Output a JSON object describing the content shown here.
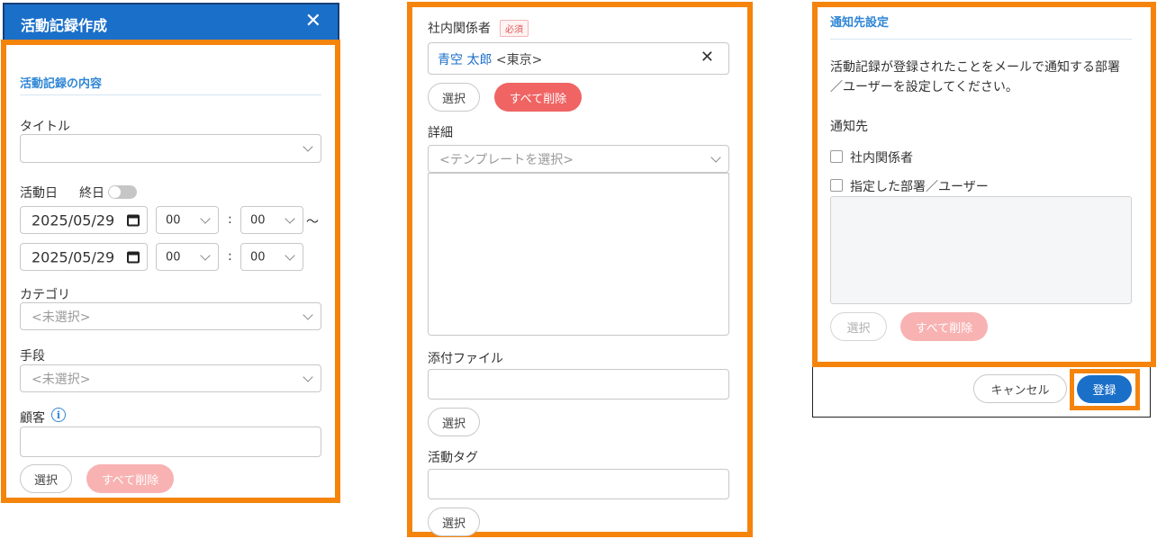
{
  "panel1": {
    "header_title": "活動記録作成",
    "close_label": "✕",
    "section_title": "活動記録の内容",
    "title_label": "タイトル",
    "activity_date_label": "活動日",
    "all_day_label": "終日",
    "start_date": "2025/05/29",
    "start_hour": "00",
    "start_min": "00",
    "colon": ":",
    "tilde": "～",
    "end_date": "2025/05/29",
    "end_hour": "00",
    "end_min": "00",
    "category_label": "カテゴリ",
    "category_placeholder": "<未選択>",
    "method_label": "手段",
    "method_placeholder": "<未選択>",
    "customer_label": "顧客",
    "info_glyph": "i",
    "select_button": "選択",
    "delete_all_button": "すべて削除"
  },
  "panel2": {
    "internal_label": "社内関係者",
    "required_badge": "必須",
    "person_name": "青空 太郎",
    "person_dept": "<東京>",
    "remove_glyph": "✕",
    "select_button": "選択",
    "delete_all_button": "すべて削除",
    "details_label": "詳細",
    "template_placeholder": "<テンプレートを選択>",
    "attachment_label": "添付ファイル",
    "attach_select_button": "選択",
    "tag_label": "活動タグ",
    "tag_select_button": "選択"
  },
  "panel3": {
    "section_title": "通知先設定",
    "description": "活動記録が登録されたことをメールで通知する部署／ユーザーを設定してください。",
    "notify_label": "通知先",
    "checkbox1_label": "社内関係者",
    "checkbox2_label": "指定した部署／ユーザー",
    "select_button": "選択",
    "delete_all_button": "すべて削除",
    "cancel_button": "キャンセル",
    "register_button": "登録"
  }
}
